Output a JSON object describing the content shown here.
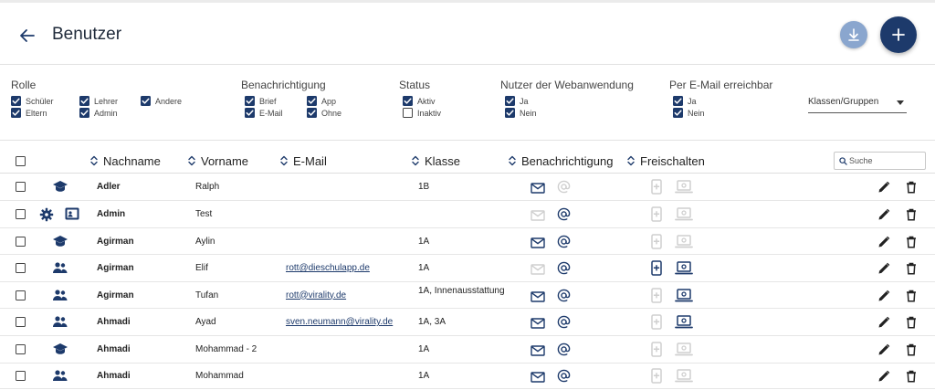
{
  "header": {
    "title": "Benutzer"
  },
  "filters": [
    {
      "title": "Rolle",
      "options": [
        {
          "label": "Schüler",
          "checked": true
        },
        {
          "label": "Eltern",
          "checked": true
        },
        {
          "label": "Lehrer",
          "checked": true
        },
        {
          "label": "Admin",
          "checked": true
        },
        {
          "label": "Andere",
          "checked": true
        }
      ]
    },
    {
      "title": "Benachrichtigung",
      "options": [
        {
          "label": "Brief",
          "checked": true
        },
        {
          "label": "E-Mail",
          "checked": true
        },
        {
          "label": "App",
          "checked": true
        },
        {
          "label": "Ohne",
          "checked": true
        }
      ]
    },
    {
      "title": "Status",
      "options": [
        {
          "label": "Aktiv",
          "checked": true
        },
        {
          "label": "Inaktiv",
          "checked": false
        }
      ]
    },
    {
      "title": "Nutzer der Webanwendung",
      "options": [
        {
          "label": "Ja",
          "checked": true
        },
        {
          "label": "Nein",
          "checked": true
        }
      ]
    },
    {
      "title": "Per E-Mail erreichbar",
      "options": [
        {
          "label": "Ja",
          "checked": true
        },
        {
          "label": "Nein",
          "checked": true
        }
      ]
    }
  ],
  "group_select": {
    "label": "Klassen/Gruppen"
  },
  "table": {
    "columns": {
      "nachname": "Nachname",
      "vorname": "Vorname",
      "email": "E-Mail",
      "klasse": "Klasse",
      "benachrichtigung": "Benachrichtigung",
      "freischalten": "Freischalten"
    },
    "search_placeholder": "Suche",
    "rows": [
      {
        "icons": [
          "student-icon"
        ],
        "nachname": "Adler",
        "vorname": "Ralph",
        "email": "",
        "klasse": "1B",
        "letter": true,
        "at": false,
        "app": false,
        "web": false
      },
      {
        "icons": [
          "gear-icon",
          "id-card-icon"
        ],
        "nachname": "Admin",
        "vorname": "Test",
        "email": "",
        "klasse": "",
        "letter": false,
        "at": true,
        "app": false,
        "web": false
      },
      {
        "icons": [
          "student-icon"
        ],
        "nachname": "Agirman",
        "vorname": "Aylin",
        "email": "",
        "klasse": "1A",
        "letter": true,
        "at": true,
        "app": false,
        "web": false
      },
      {
        "icons": [
          "parents-icon"
        ],
        "nachname": "Agirman",
        "vorname": "Elif",
        "email": "rott@dieschulapp.de",
        "klasse": "1A",
        "letter": false,
        "at": true,
        "app": true,
        "web": true
      },
      {
        "icons": [
          "parents-icon"
        ],
        "nachname": "Agirman",
        "vorname": "Tufan",
        "email": "rott@virality.de",
        "klasse": "1A, Innenausstattung",
        "letter": true,
        "at": true,
        "app": false,
        "web": true
      },
      {
        "icons": [
          "parents-icon"
        ],
        "nachname": "Ahmadi",
        "vorname": "Ayad",
        "email": "sven.neumann@virality.de",
        "klasse": "1A, 3A",
        "letter": true,
        "at": true,
        "app": false,
        "web": true
      },
      {
        "icons": [
          "student-icon"
        ],
        "nachname": "Ahmadi",
        "vorname": "Mohammad - 2",
        "email": "",
        "klasse": "1A",
        "letter": true,
        "at": true,
        "app": false,
        "web": false
      },
      {
        "icons": [
          "parents-icon"
        ],
        "nachname": "Ahmadi",
        "vorname": "Mohammad",
        "email": "",
        "klasse": "1A",
        "letter": true,
        "at": true,
        "app": false,
        "web": false
      }
    ]
  },
  "colors": {
    "primary": "#1d3a6b",
    "accent_light": "#8aa6ce",
    "inactive": "#cfcfcf"
  }
}
